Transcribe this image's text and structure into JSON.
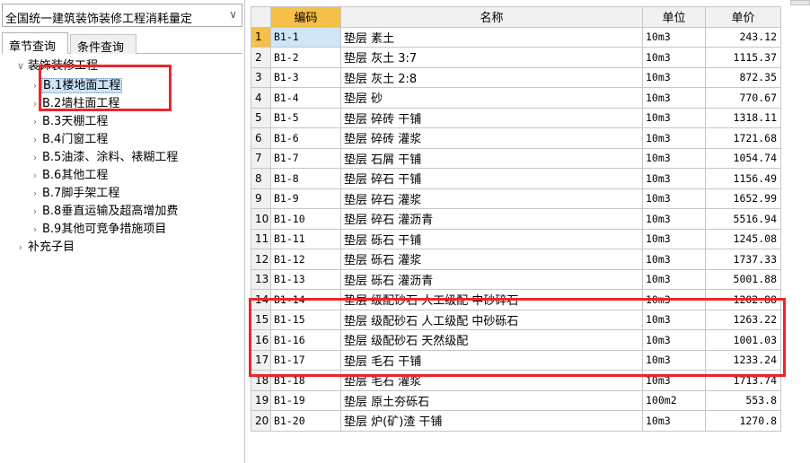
{
  "quota_select": {
    "value": "全国统一建筑装饰装修工程消耗量定",
    "arrow_icon": "chevron-down-icon"
  },
  "tabs": [
    {
      "label": "章节查询",
      "active": true
    },
    {
      "label": "条件查询",
      "active": false
    }
  ],
  "tree": [
    {
      "label": "装饰装修工程",
      "level": 0,
      "expanded": true
    },
    {
      "label": "B.1楼地面工程",
      "level": 1,
      "selected": true
    },
    {
      "label": "B.2墙柱面工程",
      "level": 1
    },
    {
      "label": "B.3天棚工程",
      "level": 1
    },
    {
      "label": "B.4门窗工程",
      "level": 1
    },
    {
      "label": "B.5油漆、涂料、裱糊工程",
      "level": 1
    },
    {
      "label": "B.6其他工程",
      "level": 1
    },
    {
      "label": "B.7脚手架工程",
      "level": 1
    },
    {
      "label": "B.8垂直运输及超高增加费",
      "level": 1
    },
    {
      "label": "B.9其他可竞争措施项目",
      "level": 1
    },
    {
      "label": "补充子目",
      "level": 0,
      "expanded": false
    }
  ],
  "table": {
    "headers": [
      "编码",
      "名称",
      "单位",
      "单价"
    ],
    "rows": [
      {
        "n": "1",
        "code": "B1-1",
        "name": "垫层 素土",
        "unit": "10m3",
        "price": "243.12"
      },
      {
        "n": "2",
        "code": "B1-2",
        "name": "垫层 灰土 3:7",
        "unit": "10m3",
        "price": "1115.37"
      },
      {
        "n": "3",
        "code": "B1-3",
        "name": "垫层 灰土 2:8",
        "unit": "10m3",
        "price": "872.35"
      },
      {
        "n": "4",
        "code": "B1-4",
        "name": "垫层 砂",
        "unit": "10m3",
        "price": "770.67"
      },
      {
        "n": "5",
        "code": "B1-5",
        "name": "垫层 碎砖 干铺",
        "unit": "10m3",
        "price": "1318.11"
      },
      {
        "n": "6",
        "code": "B1-6",
        "name": "垫层 碎砖 灌浆",
        "unit": "10m3",
        "price": "1721.68"
      },
      {
        "n": "7",
        "code": "B1-7",
        "name": "垫层 石屑 干铺",
        "unit": "10m3",
        "price": "1054.74"
      },
      {
        "n": "8",
        "code": "B1-8",
        "name": "垫层 碎石 干铺",
        "unit": "10m3",
        "price": "1156.49"
      },
      {
        "n": "9",
        "code": "B1-9",
        "name": "垫层 碎石 灌浆",
        "unit": "10m3",
        "price": "1652.99"
      },
      {
        "n": "10",
        "code": "B1-10",
        "name": "垫层 碎石 灌沥青",
        "unit": "10m3",
        "price": "5516.94"
      },
      {
        "n": "11",
        "code": "B1-11",
        "name": "垫层 砾石 干铺",
        "unit": "10m3",
        "price": "1245.08"
      },
      {
        "n": "12",
        "code": "B1-12",
        "name": "垫层 砾石 灌浆",
        "unit": "10m3",
        "price": "1737.33"
      },
      {
        "n": "13",
        "code": "B1-13",
        "name": "垫层 砾石 灌沥青",
        "unit": "10m3",
        "price": "5001.88"
      },
      {
        "n": "14",
        "code": "B1-14",
        "name": "垫层 级配砂石 人工级配 中砂碎石",
        "unit": "10m3",
        "price": "1202.88"
      },
      {
        "n": "15",
        "code": "B1-15",
        "name": "垫层 级配砂石 人工级配 中砂砾石",
        "unit": "10m3",
        "price": "1263.22"
      },
      {
        "n": "16",
        "code": "B1-16",
        "name": "垫层 级配砂石 天然级配",
        "unit": "10m3",
        "price": "1001.03"
      },
      {
        "n": "17",
        "code": "B1-17",
        "name": "垫层 毛石 干铺",
        "unit": "10m3",
        "price": "1233.24"
      },
      {
        "n": "18",
        "code": "B1-18",
        "name": "垫层 毛石 灌浆",
        "unit": "10m3",
        "price": "1713.74"
      },
      {
        "n": "19",
        "code": "B1-19",
        "name": "垫层 原土夯砾石",
        "unit": "100m2",
        "price": "553.8"
      },
      {
        "n": "20",
        "code": "B1-20",
        "name": "垫层 炉(矿)渣 干铺",
        "unit": "10m3",
        "price": "1270.8"
      }
    ]
  },
  "colors": {
    "highlight_border": "#e8282d",
    "header_accent": "#f5c04a",
    "selection": "#cce4f7"
  }
}
